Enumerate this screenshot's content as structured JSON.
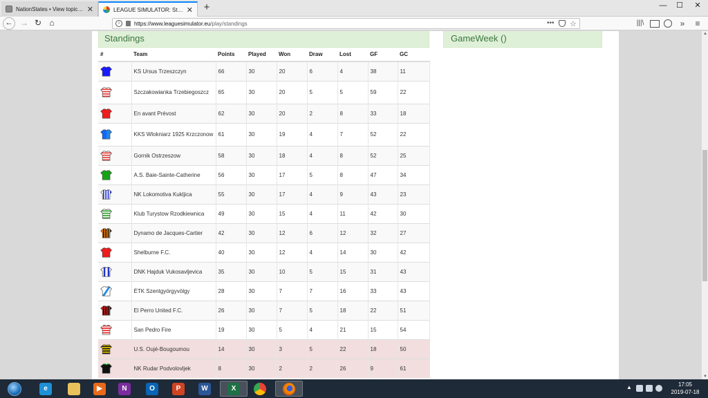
{
  "browser": {
    "tabs": [
      {
        "title": "NationStates • View topic - Ten",
        "active": false
      },
      {
        "title": "LEAGUE SIMULATOR: Standings",
        "active": true
      }
    ],
    "url_host": "https://www.leaguesimulator.eu",
    "url_path": "/play/standings",
    "window_controls": {
      "minimize": "—",
      "maximize": "☐",
      "close": "✕"
    }
  },
  "page": {
    "standings_title": "Standings",
    "gameweek_title": "GameWeek ()",
    "columns": [
      "#",
      "Team",
      "Points",
      "Played",
      "Won",
      "Draw",
      "Lost",
      "GF",
      "GC"
    ],
    "teams": [
      {
        "team": "KS Ursus Trzeszczyn",
        "points": "66",
        "played": "30",
        "won": "20",
        "draw": "6",
        "lost": "4",
        "gf": "38",
        "gc": "11",
        "shirt": {
          "kind": "solid",
          "main": "#1a1aff",
          "alt": "#1a1aff"
        }
      },
      {
        "team": "Szczakowianka Trzebiegoszcz",
        "points": "65",
        "played": "30",
        "won": "20",
        "draw": "5",
        "lost": "5",
        "gf": "59",
        "gc": "22",
        "shirt": {
          "kind": "hoops",
          "main": "#ffffff",
          "alt": "#e53935"
        }
      },
      {
        "team": "En avant Prévost",
        "points": "62",
        "played": "30",
        "won": "20",
        "draw": "2",
        "lost": "8",
        "gf": "33",
        "gc": "18",
        "shirt": {
          "kind": "solid",
          "main": "#ee1c1c",
          "alt": "#ee1c1c"
        }
      },
      {
        "team": "KKS Wlokniarz 1925 Krzczonow",
        "points": "61",
        "played": "30",
        "won": "19",
        "draw": "4",
        "lost": "7",
        "gf": "52",
        "gc": "22",
        "shirt": {
          "kind": "halves",
          "main": "#1565ff",
          "alt": "#1e88e5"
        }
      },
      {
        "team": "Gornik Ostrzeszow",
        "points": "58",
        "played": "30",
        "won": "18",
        "draw": "4",
        "lost": "8",
        "gf": "52",
        "gc": "25",
        "shirt": {
          "kind": "hoops",
          "main": "#ffffff",
          "alt": "#e53935"
        }
      },
      {
        "team": "A.S. Baie-Sainte-Catherine",
        "points": "56",
        "played": "30",
        "won": "17",
        "draw": "5",
        "lost": "8",
        "gf": "47",
        "gc": "34",
        "shirt": {
          "kind": "solid",
          "main": "#17a317",
          "alt": "#17a317"
        }
      },
      {
        "team": "NK Lokomotiva Kukljica",
        "points": "55",
        "played": "30",
        "won": "17",
        "draw": "4",
        "lost": "9",
        "gf": "43",
        "gc": "23",
        "shirt": {
          "kind": "stripes",
          "main": "#ffffff",
          "alt": "#2233cc"
        }
      },
      {
        "team": "Klub Turystow Rzodkiewnica",
        "points": "49",
        "played": "30",
        "won": "15",
        "draw": "4",
        "lost": "11",
        "gf": "42",
        "gc": "30",
        "shirt": {
          "kind": "hoops",
          "main": "#ffffff",
          "alt": "#2e9e2e"
        }
      },
      {
        "team": "Dynamo de Jacques-Cartier",
        "points": "42",
        "played": "30",
        "won": "12",
        "draw": "6",
        "lost": "12",
        "gf": "32",
        "gc": "27",
        "shirt": {
          "kind": "stripes",
          "main": "#f57c00",
          "alt": "#222222"
        }
      },
      {
        "team": "Shelburne F.C.",
        "points": "40",
        "played": "30",
        "won": "12",
        "draw": "4",
        "lost": "14",
        "gf": "30",
        "gc": "42",
        "shirt": {
          "kind": "solid",
          "main": "#ee1c1c",
          "alt": "#ee1c1c"
        }
      },
      {
        "team": "DNK Hajduk Vukosavljevica",
        "points": "35",
        "played": "30",
        "won": "10",
        "draw": "5",
        "lost": "15",
        "gf": "31",
        "gc": "43",
        "shirt": {
          "kind": "stripes-wide",
          "main": "#ffffff",
          "alt": "#2233cc"
        }
      },
      {
        "team": "ÉTK Szentgyörgyvölgy",
        "points": "28",
        "played": "30",
        "won": "7",
        "draw": "7",
        "lost": "16",
        "gf": "33",
        "gc": "43",
        "shirt": {
          "kind": "sash",
          "main": "#ffffff",
          "alt": "#1e88e5"
        }
      },
      {
        "team": "El Perro United F.C.",
        "points": "26",
        "played": "30",
        "won": "7",
        "draw": "5",
        "lost": "18",
        "gf": "22",
        "gc": "51",
        "shirt": {
          "kind": "stripes",
          "main": "#d81b1b",
          "alt": "#111111"
        }
      },
      {
        "team": "San Pedro Fire",
        "points": "19",
        "played": "30",
        "won": "5",
        "draw": "4",
        "lost": "21",
        "gf": "15",
        "gc": "54",
        "shirt": {
          "kind": "hoops",
          "main": "#ee1c1c",
          "alt": "#ffffff"
        }
      },
      {
        "team": "U.S. Oujé-Bougoumou",
        "points": "14",
        "played": "30",
        "won": "3",
        "draw": "5",
        "lost": "22",
        "gf": "18",
        "gc": "50",
        "shirt": {
          "kind": "hoops",
          "main": "#f5d000",
          "alt": "#111111"
        }
      },
      {
        "team": "NK Rudar Podvolovljek",
        "points": "8",
        "played": "30",
        "won": "2",
        "draw": "2",
        "lost": "26",
        "gf": "9",
        "gc": "61",
        "shirt": {
          "kind": "solid",
          "main": "#111111",
          "alt": "#1faa1f"
        }
      }
    ],
    "relegation_color": "#f2dede"
  },
  "taskbar": {
    "apps": [
      {
        "name": "internet-explorer-icon",
        "glyph": "e",
        "color": "#1e90d6"
      },
      {
        "name": "file-explorer-icon",
        "glyph": "",
        "color": "#e8c25a"
      },
      {
        "name": "media-player-icon",
        "glyph": "▶",
        "color": "#e86a1a"
      },
      {
        "name": "onenote-icon",
        "glyph": "N",
        "color": "#7b2c9e"
      },
      {
        "name": "outlook-icon",
        "glyph": "O",
        "color": "#0a64b4"
      },
      {
        "name": "powerpoint-icon",
        "glyph": "P",
        "color": "#d04423"
      },
      {
        "name": "word-icon",
        "glyph": "W",
        "color": "#2b5797"
      },
      {
        "name": "excel-icon",
        "glyph": "X",
        "color": "#1e7145"
      },
      {
        "name": "chrome-icon",
        "glyph": "",
        "color": "#4caf50"
      },
      {
        "name": "firefox-icon",
        "glyph": "",
        "color": "#e66000"
      }
    ],
    "active_app": "firefox-icon",
    "time": "17:05",
    "date": "2019-07-18"
  }
}
